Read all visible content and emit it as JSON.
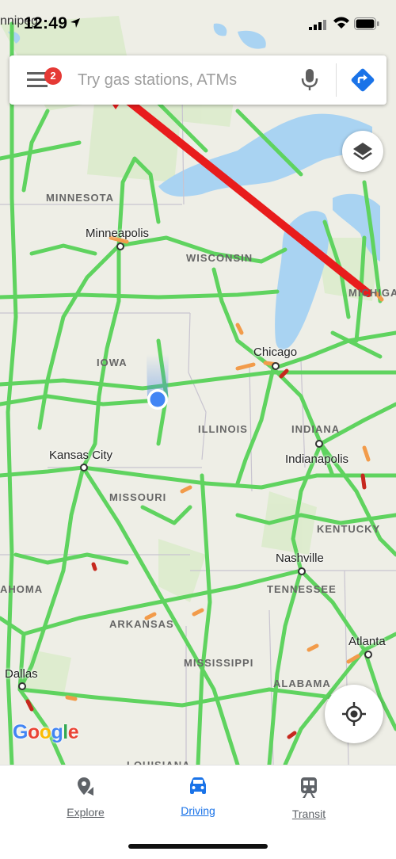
{
  "status_bar": {
    "time": "12:49"
  },
  "search": {
    "placeholder": "Try gas stations, ATMs",
    "notification_count": "2"
  },
  "map": {
    "top_left_label": "nnipeg",
    "states": [
      "MINNESOTA",
      "WISCONSIN",
      "MICHIGAN",
      "IOWA",
      "ILLINOIS",
      "INDIANA",
      "MISSOURI",
      "KENTUCKY",
      "TENNESSEE",
      "AHOMA",
      "ARKANSAS",
      "MISSISSIPPI",
      "ALABAMA",
      "LOUISIANA"
    ],
    "cities": [
      "Minneapolis",
      "Chicago",
      "Kansas City",
      "Indianapolis",
      "Nashville",
      "Atlanta",
      "Dallas"
    ],
    "logo": "Google",
    "colors": {
      "water": "#a9d3f2",
      "land": "#eeeee6",
      "traffic_clear": "#5fd35f",
      "traffic_slow": "#f29b4a",
      "traffic_heavy": "#c6281e",
      "annotation_arrow": "#e81c1c",
      "accent": "#1a73e8"
    }
  },
  "bottom_nav": {
    "items": [
      {
        "label": "Explore",
        "icon": "map-pin-icon"
      },
      {
        "label": "Driving",
        "icon": "car-icon",
        "active": true
      },
      {
        "label": "Transit",
        "icon": "train-icon"
      }
    ]
  }
}
